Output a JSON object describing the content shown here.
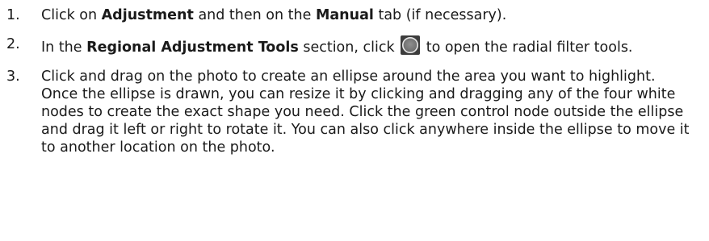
{
  "steps": [
    {
      "number": "1.",
      "parts": [
        "Click on ",
        "Adjustment",
        " and then on the ",
        "Manual",
        " tab (if necessary)."
      ]
    },
    {
      "number": "2.",
      "parts": [
        "In the ",
        "Regional Adjustment Tools",
        " section, click ",
        " to open the radial filter tools."
      ],
      "icon": "radial-filter-icon"
    },
    {
      "number": "3.",
      "text": "Click and drag on the photo to create an ellipse around the area you want to highlight. Once the ellipse is drawn, you can resize it by clicking and dragging any of the four white nodes to create the exact shape you need. Click the green control node outside the ellipse and drag it left or right to rotate it. You can also click anywhere inside the ellipse to move it to another location on the photo."
    }
  ],
  "colors": {
    "text": "#1a1a1a",
    "icon_outer": "#555555",
    "icon_inner": "#7a7a7a"
  }
}
